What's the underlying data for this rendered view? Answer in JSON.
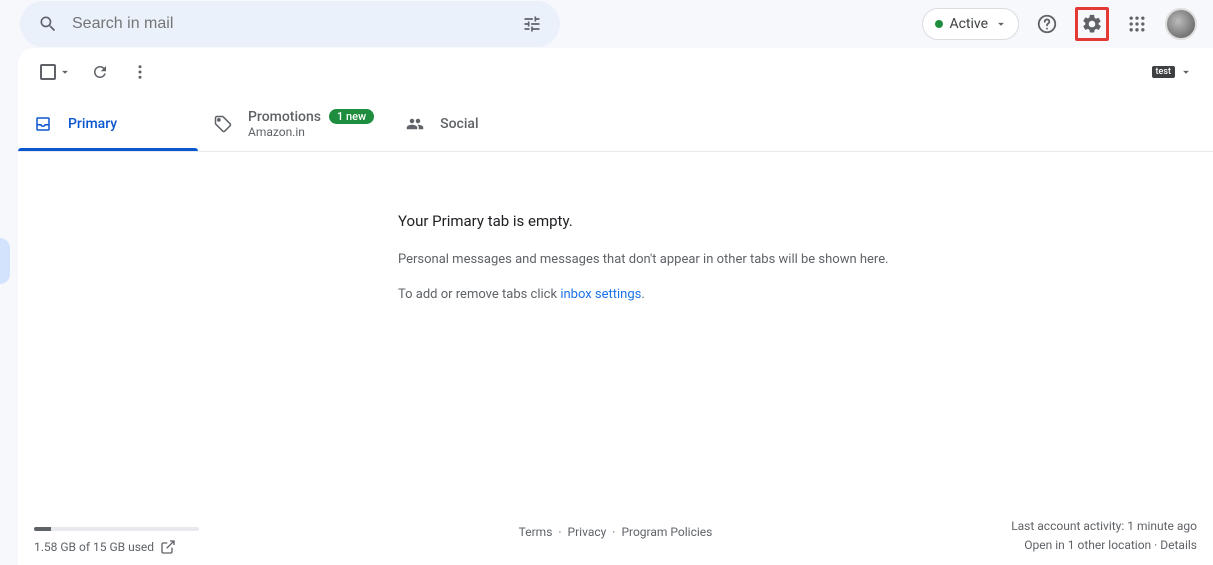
{
  "header": {
    "search_placeholder": "Search in mail",
    "active_label": "Active"
  },
  "toolbar": {
    "keyboard_badge": "test"
  },
  "tabs": [
    {
      "label": "Primary",
      "sublabel": "",
      "badge": "",
      "active": true
    },
    {
      "label": "Promotions",
      "sublabel": "Amazon.in",
      "badge": "1 new",
      "active": false
    },
    {
      "label": "Social",
      "sublabel": "",
      "badge": "",
      "active": false
    }
  ],
  "empty": {
    "title": "Your Primary tab is empty.",
    "subtitle": "Personal messages and messages that don't appear in other tabs will be shown here.",
    "action_prefix": "To add or remove tabs click ",
    "action_link": "inbox settings",
    "action_suffix": "."
  },
  "footer": {
    "storage_text": "1.58 GB of 15 GB used",
    "storage_percent": 10.5,
    "terms": "Terms",
    "privacy": "Privacy",
    "policies": "Program Policies",
    "activity_line": "Last account activity: 1 minute ago",
    "open_line_prefix": "Open in 1 other location · ",
    "details": "Details"
  }
}
